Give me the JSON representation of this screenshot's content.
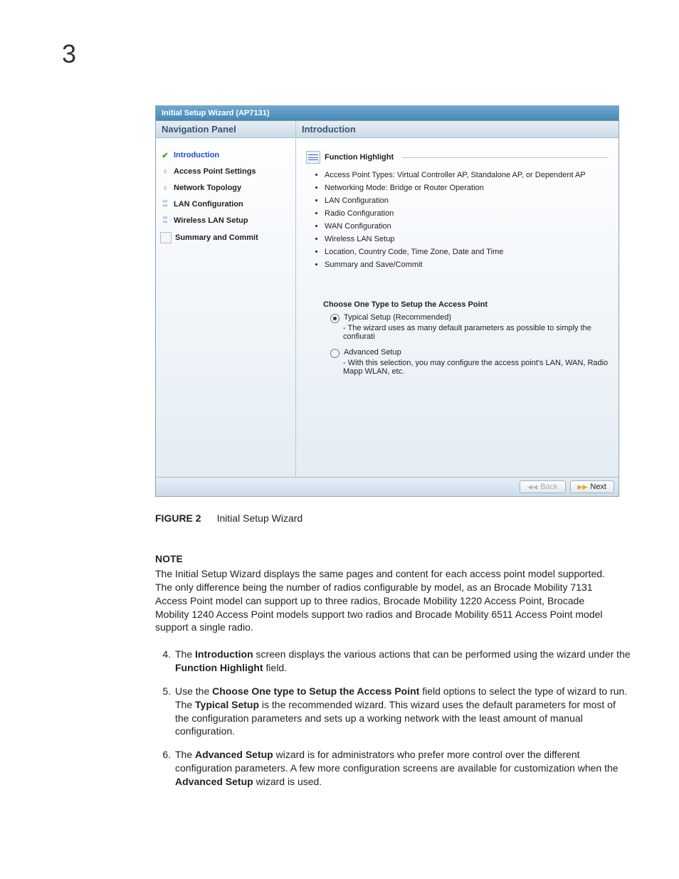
{
  "chapter_number": "3",
  "screenshot": {
    "title": "Initial Setup Wizard (AP7131)",
    "nav_header": "Navigation Panel",
    "main_header": "Introduction",
    "nav_items": [
      {
        "label": "Introduction",
        "icon": "check"
      },
      {
        "label": "Access Point Settings",
        "icon": "ap"
      },
      {
        "label": "Network Topology",
        "icon": "ap"
      },
      {
        "label": "LAN Configuration",
        "icon": "lan"
      },
      {
        "label": "Wireless LAN Setup",
        "icon": "lan"
      },
      {
        "label": "Summary and Commit",
        "icon": "sum"
      }
    ],
    "fh_title": "Function Highlight",
    "fh_items": [
      "Access Point Types: Virtual Controller AP, Standalone AP, or Dependent AP",
      "Networking Mode: Bridge or Router Operation",
      "LAN Configuration",
      "Radio Configuration",
      "WAN Configuration",
      "Wireless LAN Setup",
      "Location, Country Code, Time Zone, Date and Time",
      "Summary and Save/Commit"
    ],
    "choose_header": "Choose One Type to Setup the Access Point",
    "radios": [
      {
        "label": "Typical Setup (Recommended)",
        "desc": "- The wizard uses as many default parameters as possible to simply the confiurati",
        "selected": true
      },
      {
        "label": "Advanced Setup",
        "desc": "- With this selection, you may configure the access point's LAN, WAN, Radio Mapp WLAN, etc.",
        "selected": false
      }
    ],
    "back_label": "Back",
    "next_label": "Next"
  },
  "figure": {
    "num": "FIGURE 2",
    "caption": "Initial Setup Wizard"
  },
  "note": {
    "heading": "NOTE",
    "body": "The Initial Setup Wizard displays the same pages and content for each access point model supported. The only difference being the number of radios configurable by model, as an Brocade Mobility 7131 Access Point model can support up to three radios, Brocade Mobility 1220 Access Point, Brocade Mobility 1240 Access Point models support two radios and Brocade Mobility 6511 Access Point model support a single radio."
  },
  "steps": {
    "s4_a": "The ",
    "s4_b": "Introduction",
    "s4_c": " screen displays the various actions that can be performed using the wizard under the ",
    "s4_d": "Function Highlight",
    "s4_e": " field.",
    "s5_a": "Use the ",
    "s5_b": "Choose One type to Setup the Access Point",
    "s5_c": " field options to select the type of wizard to run. The ",
    "s5_d": "Typical Setup",
    "s5_e": " is the recommended wizard. This wizard uses the default parameters for most of the configuration parameters and sets up a working network with the least amount of manual configuration.",
    "s6_a": "The ",
    "s6_b": "Advanced Setup",
    "s6_c": " wizard is for administrators who prefer more control over the different configuration parameters. A few more configuration screens are available for customization when the ",
    "s6_d": "Advanced Setup",
    "s6_e": " wizard is used."
  }
}
